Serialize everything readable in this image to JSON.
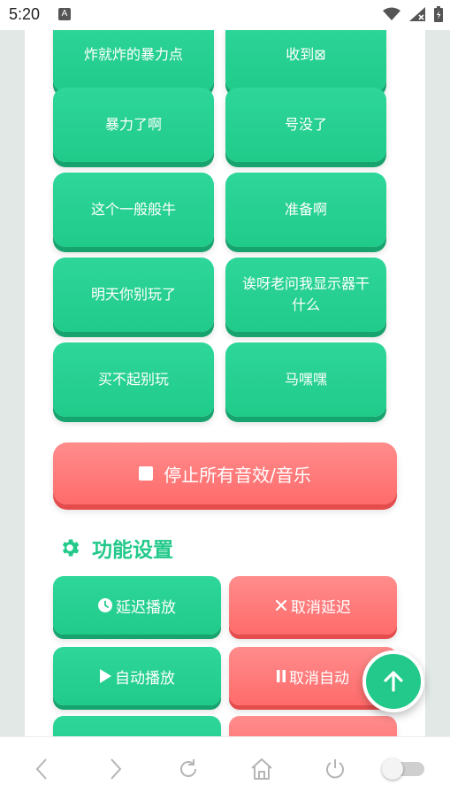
{
  "status_bar": {
    "time": "5:20",
    "notification_letter": "A"
  },
  "sound_buttons": [
    {
      "label": "炸就炸的暴力点"
    },
    {
      "label": "收到⊠"
    },
    {
      "label": "暴力了啊"
    },
    {
      "label": "号没了"
    },
    {
      "label": "这个一般般牛"
    },
    {
      "label": "准备啊"
    },
    {
      "label": "明天你别玩了"
    },
    {
      "label": "诶呀老问我显示器干什么"
    },
    {
      "label": "买不起别玩"
    },
    {
      "label": "马嘿嘿"
    }
  ],
  "stop_all": {
    "label": "停止所有音效/音乐"
  },
  "settings": {
    "title": "功能设置",
    "buttons": [
      {
        "label": "延迟播放",
        "icon": "clock-icon",
        "style": "green"
      },
      {
        "label": "取消延迟",
        "icon": "x-icon",
        "style": "red"
      },
      {
        "label": "自动播放",
        "icon": "play-icon",
        "style": "green"
      },
      {
        "label": "取消自动",
        "icon": "pause-icon",
        "style": "red"
      }
    ]
  },
  "colors": {
    "accent": "#22c98a",
    "danger": "#ff6b6b"
  }
}
